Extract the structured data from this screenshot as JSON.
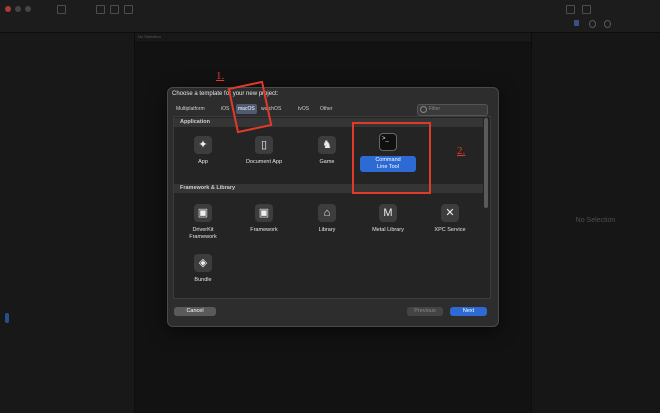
{
  "editor": {
    "jump_bar_text": "No Selection"
  },
  "inspector": {
    "empty_text": "No Selection"
  },
  "dialog": {
    "title": "Choose a template for your new project:",
    "tabs": [
      {
        "label": "Multiplatform"
      },
      {
        "label": "iOS"
      },
      {
        "label": "macOS",
        "selected": true
      },
      {
        "label": "watchOS"
      },
      {
        "label": "tvOS"
      },
      {
        "label": "Other"
      }
    ],
    "filter": {
      "placeholder": "Filter"
    },
    "sections": [
      {
        "title": "Application",
        "templates": [
          {
            "label": "App",
            "icon": "app-store-icon"
          },
          {
            "label": "Document App",
            "icon": "document-icon"
          },
          {
            "label": "Game",
            "icon": "game-controller-icon"
          },
          {
            "label": "Command\nLine Tool",
            "icon": "terminal-icon",
            "selected": true
          }
        ]
      },
      {
        "title": "Framework & Library",
        "templates": [
          {
            "label": "DriverKit\nFramework",
            "icon": "toolbox-icon"
          },
          {
            "label": "Framework",
            "icon": "toolbox-icon"
          },
          {
            "label": "Library",
            "icon": "library-icon"
          },
          {
            "label": "Metal Library",
            "icon": "metal-icon"
          },
          {
            "label": "XPC Service",
            "icon": "tools-icon"
          },
          {
            "label": "Bundle",
            "icon": "cube-icon"
          }
        ]
      }
    ],
    "buttons": {
      "cancel": "Cancel",
      "previous": "Previous",
      "next": "Next"
    }
  },
  "annotations": {
    "step1": "1.",
    "step2": "2."
  },
  "colors": {
    "accent": "#2d6ad4",
    "annotation": "#e03a2a"
  }
}
